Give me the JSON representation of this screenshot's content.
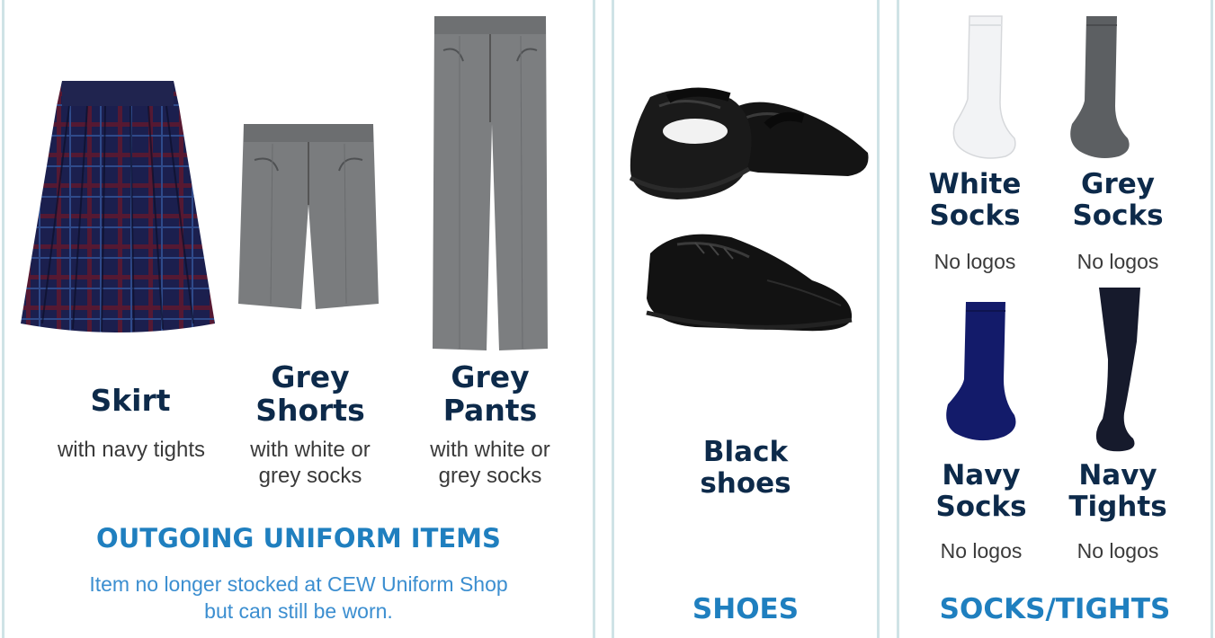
{
  "colors": {
    "panel_border": "#cfe3e6",
    "item_title": "#0d2a4a",
    "section_heading": "#1f7fbf",
    "note_text": "#3b8ed0",
    "navy": "#15205c",
    "grey_fabric": "#7a7c7e"
  },
  "outgoing": {
    "items": [
      {
        "name": "Skirt",
        "sub": "with navy tights",
        "icon": "tartan-skirt-image"
      },
      {
        "name_line1": "Grey",
        "name_line2": "Shorts",
        "sub_line1": "with white or",
        "sub_line2": "grey socks",
        "icon": "grey-shorts-image"
      },
      {
        "name_line1": "Grey",
        "name_line2": "Pants",
        "sub_line1": "with white or",
        "sub_line2": "grey socks",
        "icon": "grey-pants-image"
      }
    ],
    "heading": "OUTGOING UNIFORM ITEMS",
    "note_line1": "Item no longer stocked at CEW Uniform Shop",
    "note_line2": "but can still be worn."
  },
  "shoes": {
    "name_line1": "Black",
    "name_line2": "shoes",
    "heading": "SHOES",
    "icons": [
      "mary-jane-shoes-image",
      "lace-up-shoe-image"
    ]
  },
  "socks": {
    "items": [
      {
        "name_line1": "White",
        "name_line2": "Socks",
        "sub": "No logos",
        "icon": "white-sock-image"
      },
      {
        "name_line1": "Grey",
        "name_line2": "Socks",
        "sub": "No logos",
        "icon": "grey-sock-image"
      },
      {
        "name_line1": "Navy",
        "name_line2": "Socks",
        "sub": "No logos",
        "icon": "navy-sock-image"
      },
      {
        "name_line1": "Navy",
        "name_line2": "Tights",
        "sub": "No logos",
        "icon": "navy-tights-image"
      }
    ],
    "heading": "SOCKS/TIGHTS"
  }
}
